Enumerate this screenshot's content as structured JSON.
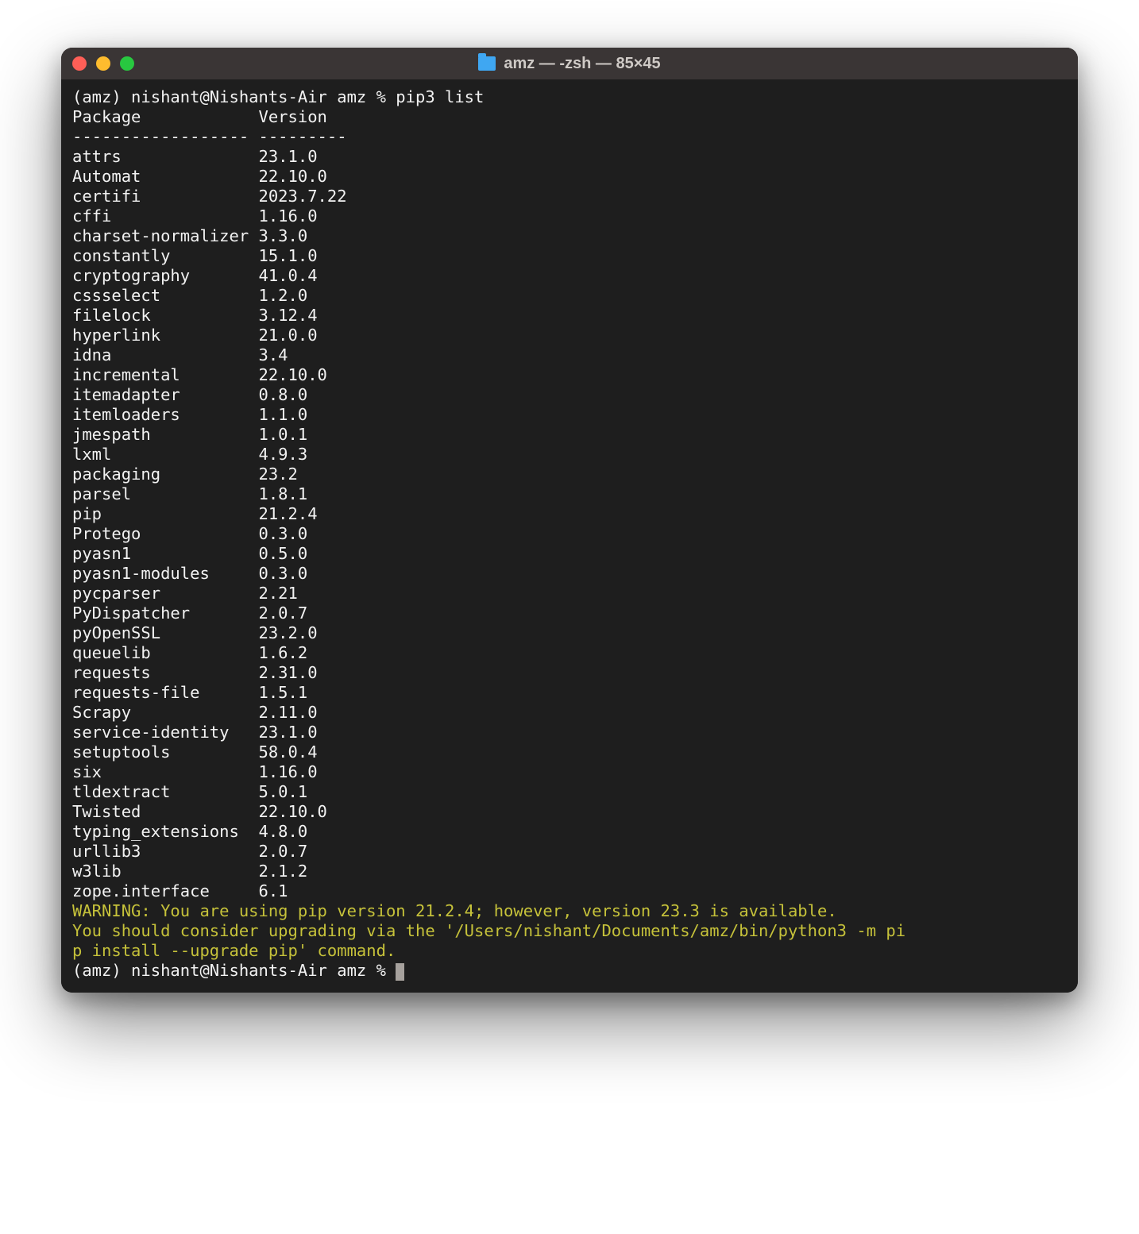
{
  "window": {
    "title": "amz — -zsh — 85×45"
  },
  "terminal": {
    "prompt1": "(amz) nishant@Nishants-Air amz % pip3 list",
    "header_package": "Package",
    "header_version": "Version",
    "sep_package": "------------------",
    "sep_version": "---------",
    "packages": [
      {
        "name": "attrs",
        "version": "23.1.0"
      },
      {
        "name": "Automat",
        "version": "22.10.0"
      },
      {
        "name": "certifi",
        "version": "2023.7.22"
      },
      {
        "name": "cffi",
        "version": "1.16.0"
      },
      {
        "name": "charset-normalizer",
        "version": "3.3.0"
      },
      {
        "name": "constantly",
        "version": "15.1.0"
      },
      {
        "name": "cryptography",
        "version": "41.0.4"
      },
      {
        "name": "cssselect",
        "version": "1.2.0"
      },
      {
        "name": "filelock",
        "version": "3.12.4"
      },
      {
        "name": "hyperlink",
        "version": "21.0.0"
      },
      {
        "name": "idna",
        "version": "3.4"
      },
      {
        "name": "incremental",
        "version": "22.10.0"
      },
      {
        "name": "itemadapter",
        "version": "0.8.0"
      },
      {
        "name": "itemloaders",
        "version": "1.1.0"
      },
      {
        "name": "jmespath",
        "version": "1.0.1"
      },
      {
        "name": "lxml",
        "version": "4.9.3"
      },
      {
        "name": "packaging",
        "version": "23.2"
      },
      {
        "name": "parsel",
        "version": "1.8.1"
      },
      {
        "name": "pip",
        "version": "21.2.4"
      },
      {
        "name": "Protego",
        "version": "0.3.0"
      },
      {
        "name": "pyasn1",
        "version": "0.5.0"
      },
      {
        "name": "pyasn1-modules",
        "version": "0.3.0"
      },
      {
        "name": "pycparser",
        "version": "2.21"
      },
      {
        "name": "PyDispatcher",
        "version": "2.0.7"
      },
      {
        "name": "pyOpenSSL",
        "version": "23.2.0"
      },
      {
        "name": "queuelib",
        "version": "1.6.2"
      },
      {
        "name": "requests",
        "version": "2.31.0"
      },
      {
        "name": "requests-file",
        "version": "1.5.1"
      },
      {
        "name": "Scrapy",
        "version": "2.11.0"
      },
      {
        "name": "service-identity",
        "version": "23.1.0"
      },
      {
        "name": "setuptools",
        "version": "58.0.4"
      },
      {
        "name": "six",
        "version": "1.16.0"
      },
      {
        "name": "tldextract",
        "version": "5.0.1"
      },
      {
        "name": "Twisted",
        "version": "22.10.0"
      },
      {
        "name": "typing_extensions",
        "version": "4.8.0"
      },
      {
        "name": "urllib3",
        "version": "2.0.7"
      },
      {
        "name": "w3lib",
        "version": "2.1.2"
      },
      {
        "name": "zope.interface",
        "version": "6.1"
      }
    ],
    "warning_line1": "WARNING: You are using pip version 21.2.4; however, version 23.3 is available.",
    "warning_line2": "You should consider upgrading via the '/Users/nishant/Documents/amz/bin/python3 -m pip install --upgrade pip' command.",
    "prompt2": "(amz) nishant@Nishants-Air amz % "
  }
}
